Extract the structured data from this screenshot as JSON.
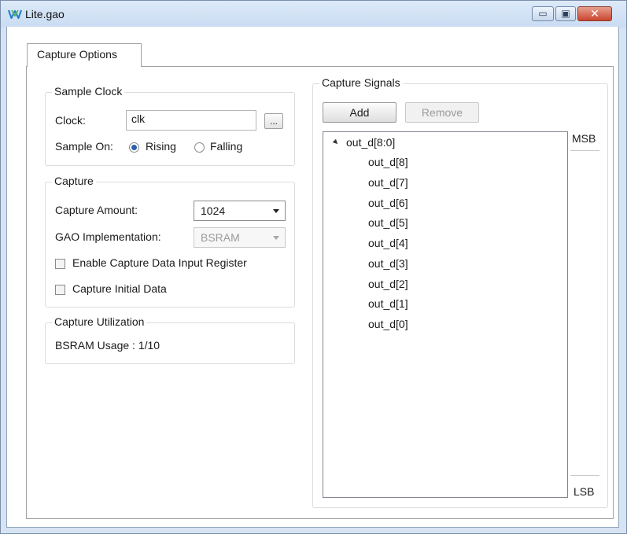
{
  "window": {
    "title": "Lite.gao",
    "minimize_glyph": "▭",
    "maximize_glyph": "▣",
    "close_glyph": "✕"
  },
  "tabs": [
    {
      "label": "Capture Options",
      "active": true
    }
  ],
  "sample_clock": {
    "title": "Sample Clock",
    "clock_label": "Clock:",
    "clock_value": "clk",
    "browse_label": "...",
    "sample_on_label": "Sample On:",
    "rising_label": "Rising",
    "falling_label": "Falling",
    "selected": "Rising"
  },
  "capture": {
    "title": "Capture",
    "amount_label": "Capture Amount:",
    "amount_value": "1024",
    "gao_label": "GAO Implementation:",
    "gao_value": "BSRAM",
    "enable_input_register_label": "Enable Capture Data Input Register",
    "enable_input_register_checked": false,
    "capture_initial_label": "Capture Initial Data",
    "capture_initial_checked": false
  },
  "utilization": {
    "title": "Capture Utilization",
    "usage_text": "BSRAM Usage : 1/10"
  },
  "capture_signals": {
    "title": "Capture Signals",
    "add_label": "Add",
    "remove_label": "Remove",
    "msb_label": "MSB",
    "lsb_label": "LSB",
    "tree": {
      "parent": "out_d[8:0]",
      "children": [
        "out_d[8]",
        "out_d[7]",
        "out_d[6]",
        "out_d[5]",
        "out_d[4]",
        "out_d[3]",
        "out_d[2]",
        "out_d[1]",
        "out_d[0]"
      ]
    }
  },
  "colors": {
    "titlebar": "#c9dcf2",
    "radio_selected": "#2b5fae",
    "close_button": "#c9452f"
  }
}
